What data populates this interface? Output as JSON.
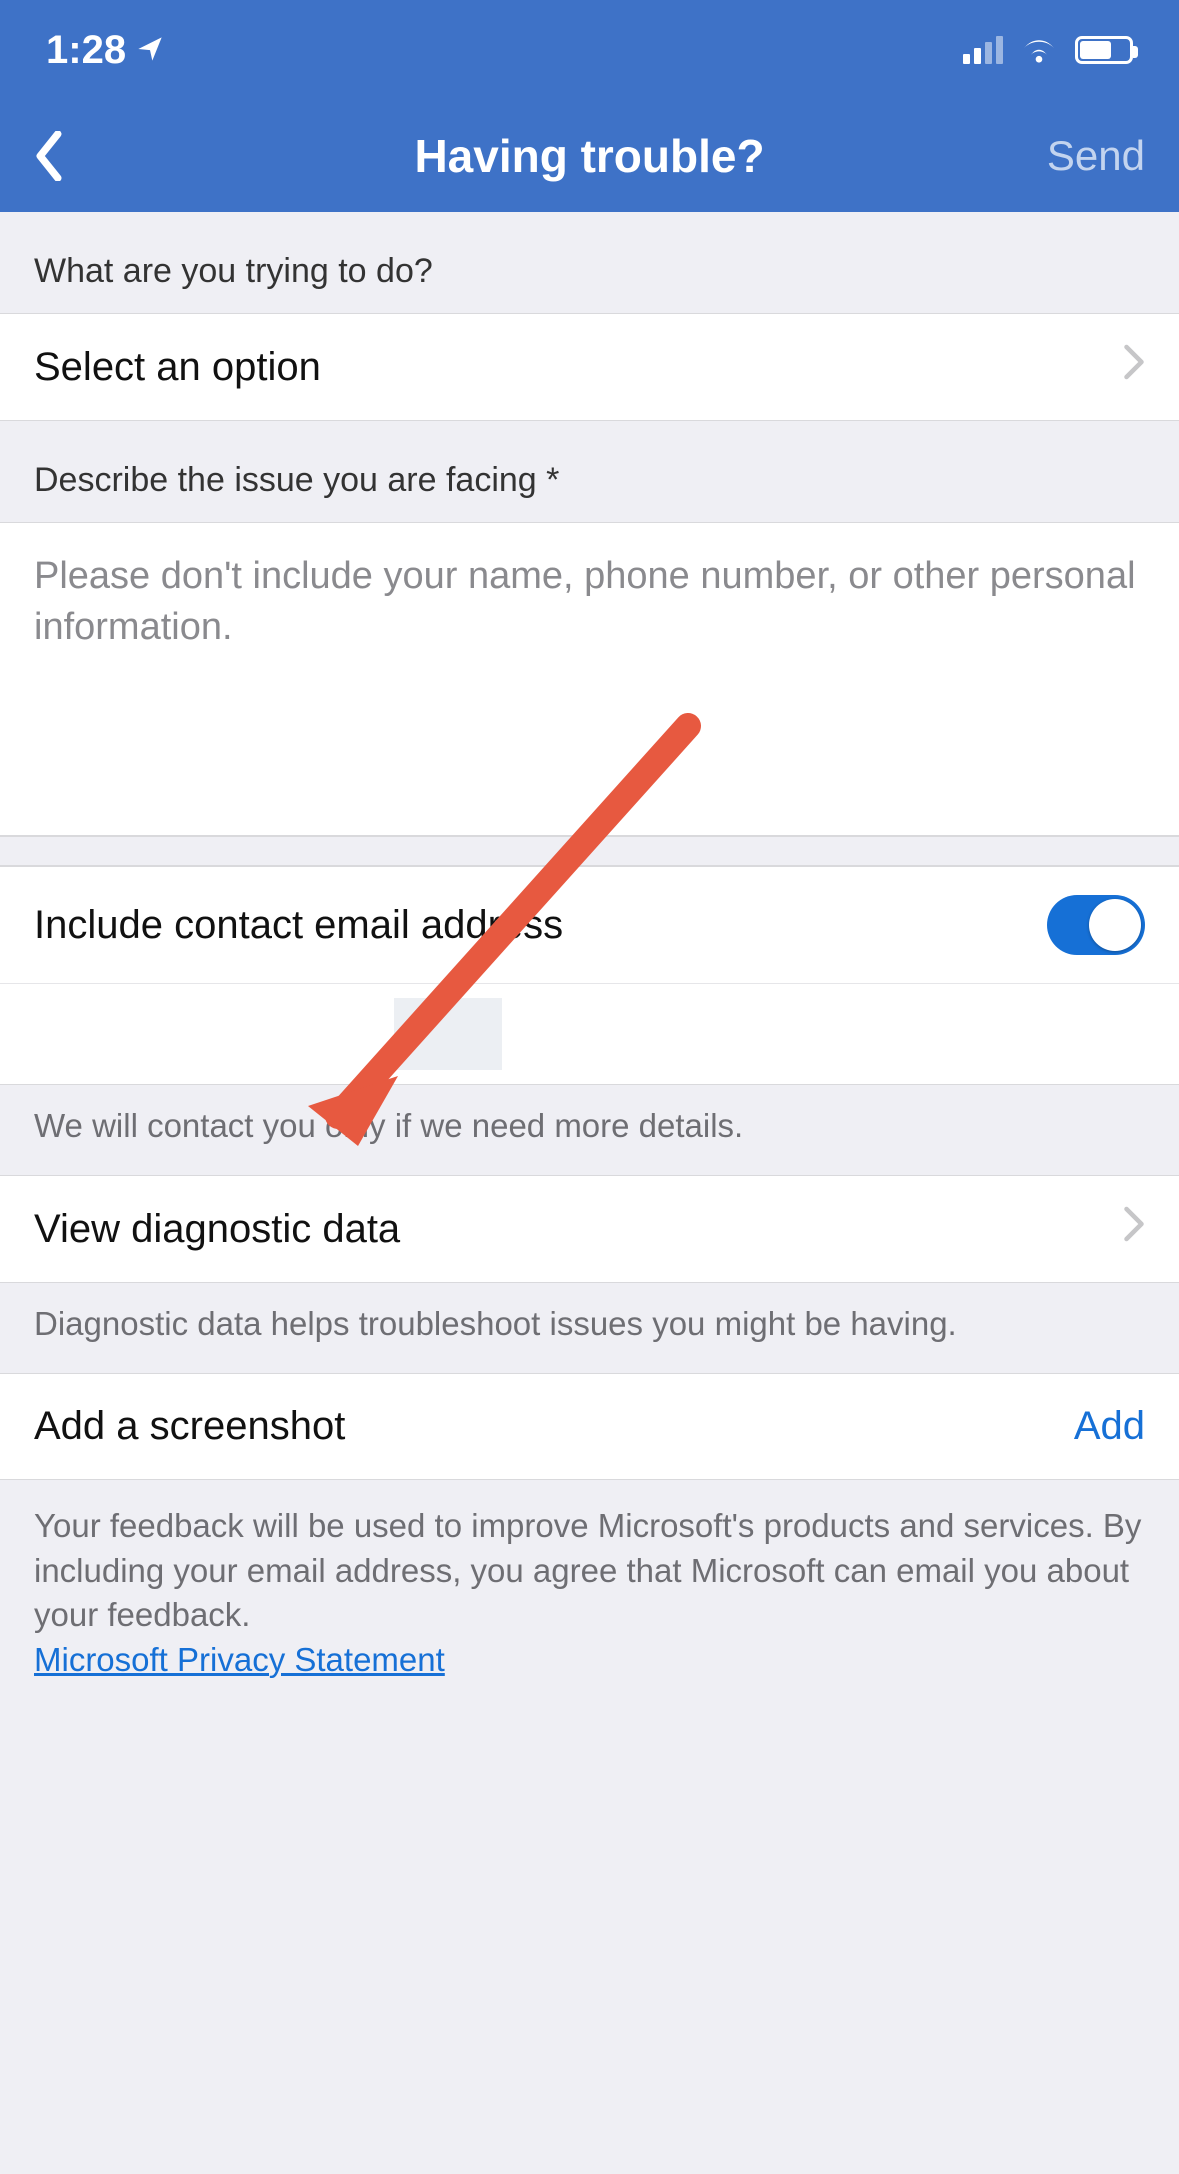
{
  "status": {
    "time": "1:28"
  },
  "nav": {
    "title": "Having trouble?",
    "send": "Send"
  },
  "section1": {
    "label": "What are you trying to do?",
    "select_placeholder": "Select an option"
  },
  "section2": {
    "label": "Describe the issue you are facing *",
    "placeholder": "Please don't include your name, phone number, or other personal information."
  },
  "email": {
    "label": "Include contact email address",
    "toggle_on": true,
    "footer": "We will contact you only if we need more details."
  },
  "diag": {
    "label": "View diagnostic data",
    "footer": "Diagnostic data helps troubleshoot issues you might be having."
  },
  "shot": {
    "label": "Add a screenshot",
    "action": "Add"
  },
  "footer": {
    "text": "Your feedback will be used to improve Microsoft's products and services. By including your email address, you agree that Microsoft can email you about your feedback.",
    "link": "Microsoft Privacy Statement"
  }
}
